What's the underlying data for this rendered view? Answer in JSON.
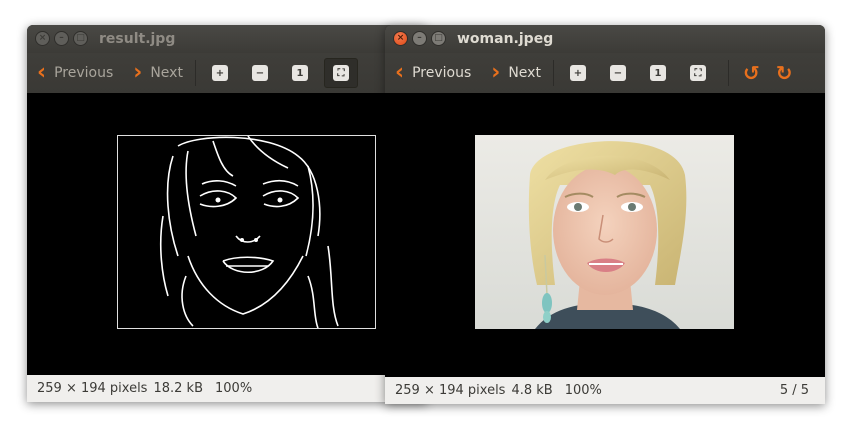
{
  "windowA": {
    "title": "result.jpg",
    "toolbar": {
      "previous": "Previous",
      "next": "Next"
    },
    "status": {
      "dimensions": "259 × 194 pixels",
      "size": "18.2 kB",
      "zoom": "100%"
    }
  },
  "windowB": {
    "title": "woman.jpeg",
    "toolbar": {
      "previous": "Previous",
      "next": "Next"
    },
    "status": {
      "dimensions": "259 × 194 pixels",
      "size": "4.8 kB",
      "zoom": "100%",
      "position": "5 / 5"
    }
  },
  "icons": {
    "close": "close-icon",
    "minimize": "minimize-icon",
    "maximize": "maximize-icon",
    "zoom_in": "zoom-in-icon",
    "zoom_out": "zoom-out-icon",
    "normal_size": "normal-size-icon",
    "best_fit": "best-fit-icon",
    "rotate_left": "rotate-left-icon",
    "rotate_right": "rotate-right-icon"
  },
  "colors": {
    "accent": "#e8701d",
    "titlebar": "#3c3b37",
    "statusbar": "#f0efed"
  }
}
